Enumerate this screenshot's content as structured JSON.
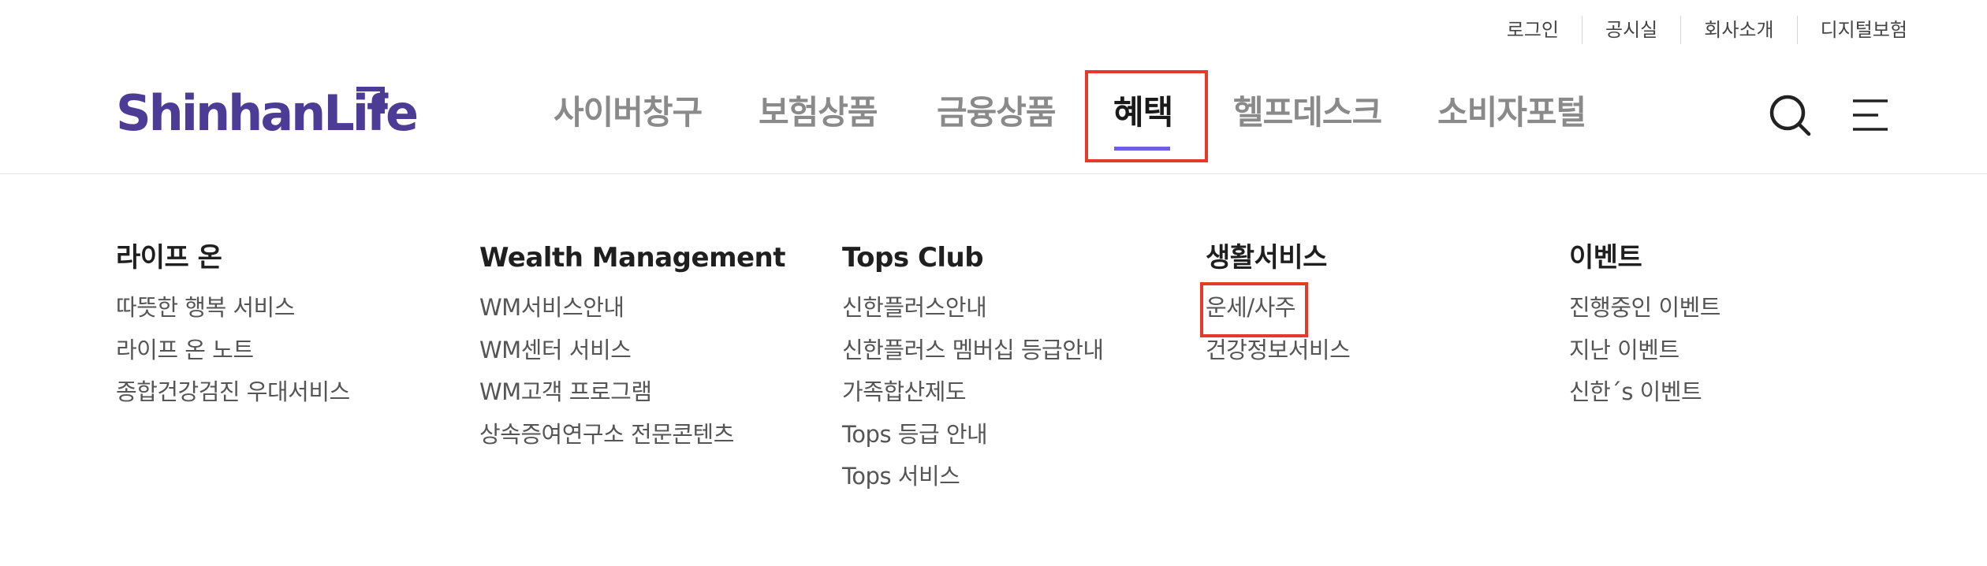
{
  "utility_links": [
    "로그인",
    "공시실",
    "회사소개",
    "디지털보험"
  ],
  "logo": {
    "text": "ShinhanLife"
  },
  "nav": {
    "items": [
      "사이버창구",
      "보험상품",
      "금융상품",
      "혜택",
      "헬프데스크",
      "소비자포털"
    ],
    "active_index": 3
  },
  "icons": {
    "search": "search-icon",
    "menu": "hamburger-menu-icon"
  },
  "colors": {
    "brand": "#4c3c95",
    "active_underline": "#6f5ee6",
    "highlight_box": "#e53a2a"
  },
  "columns": [
    {
      "title": "라이프 온",
      "items": [
        "따뜻한 행복 서비스",
        "라이프 온 노트",
        "종합건강검진 우대서비스"
      ]
    },
    {
      "title": "Wealth Management",
      "items": [
        "WM서비스안내",
        "WM센터 서비스",
        "WM고객 프로그램",
        "상속증여연구소 전문콘텐츠"
      ]
    },
    {
      "title": "Tops Club",
      "items": [
        "신한플러스안내",
        "신한플러스 멤버십 등급안내",
        "가족합산제도",
        "Tops 등급 안내",
        "Tops 서비스"
      ]
    },
    {
      "title": "생활서비스",
      "items": [
        "운세/사주",
        "건강정보서비스"
      ]
    },
    {
      "title": "이벤트",
      "items": [
        "진행중인 이벤트",
        "지난 이벤트",
        "신한´s 이벤트"
      ]
    }
  ]
}
